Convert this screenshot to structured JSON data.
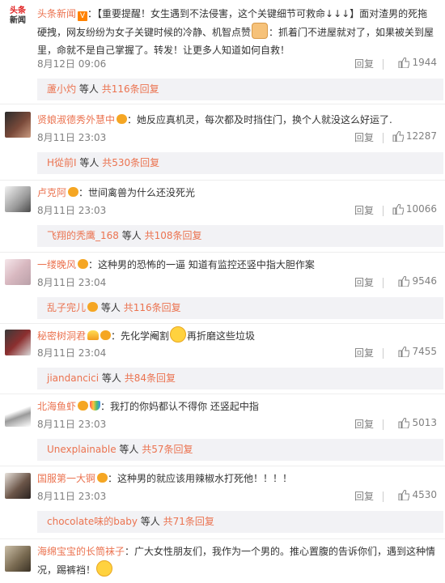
{
  "logo": {
    "line1": "头条",
    "line2": "新闻"
  },
  "post": {
    "author": "头条新闻",
    "body_a": "：【重要提醒！女生遇到不法侵害，这个关键细节可救命↓↓↓】面对渣男的死拖硬拽，网友纷纷为女子关键时候的冷静、机智点赞",
    "body_b": "：抓着门不进屋就对了，如果被关到屋里，命就不是自己掌握了。转发！让更多人知道如何自救！",
    "time": "8月12日 09:06",
    "reply_label": "回复",
    "likes": "1944",
    "replies": {
      "name": "蘆小灼",
      "middle": "等人",
      "count": "共116条回复"
    }
  },
  "comments": [
    {
      "name": "贤娘淑德秀外慧中",
      "text": "：她反应真机灵，每次都及时挡住门，换个人就没这么好运了.",
      "time": "8月11日 23:03",
      "likes": "12287",
      "reply": {
        "name": "H從前I",
        "middle": "等人",
        "count": "共530条回复"
      }
    },
    {
      "name": "卢克阿",
      "text": "：世间禽兽为什么还没死光",
      "time": "8月11日 23:03",
      "likes": "10066",
      "reply": {
        "name": "飞翔的秃鹰_168",
        "middle": "等人",
        "count": "共108条回复"
      }
    },
    {
      "name": "一缕晚风",
      "text": "：这种男的恐怖的一逼 知道有监控还竖中指大胆作案",
      "time": "8月11日 23:04",
      "likes": "9546",
      "reply": {
        "name": "乱子完儿",
        "middle": "等人",
        "count": "共116条回复"
      }
    },
    {
      "name": "秘密树洞君",
      "text_a": "：先化学阉割",
      "text_b": "再折磨这些垃圾",
      "time": "8月11日 23:04",
      "likes": "7455",
      "reply": {
        "name": "jiandancici",
        "middle": "等人",
        "count": "共84条回复"
      }
    },
    {
      "name": "北海鱼虾",
      "text": "：我打的你妈都认不得你 还竖起中指",
      "time": "8月11日 23:03",
      "likes": "5013",
      "reply": {
        "name": "Unexplainable",
        "middle": "等人",
        "count": "共57条回复"
      }
    },
    {
      "name": "国服第一大锕",
      "text": "：这种男的就应该用辣椒水打死他！！！！",
      "time": "8月11日 23:03",
      "likes": "4530",
      "reply": {
        "name": "chocolate味的baby",
        "middle": "等人",
        "count": "共71条回复"
      }
    },
    {
      "name": "海绵宝宝的长筒袜子",
      "text": "：广大女性朋友们，我作为一个男的。推心置腹的告诉你们，遇到这种情况，踢裤裆！"
    }
  ],
  "reply_label": "回复",
  "colors": {
    "name": "#eb7350",
    "meta": "#808080",
    "reply_bg": "#f2f2f5"
  }
}
